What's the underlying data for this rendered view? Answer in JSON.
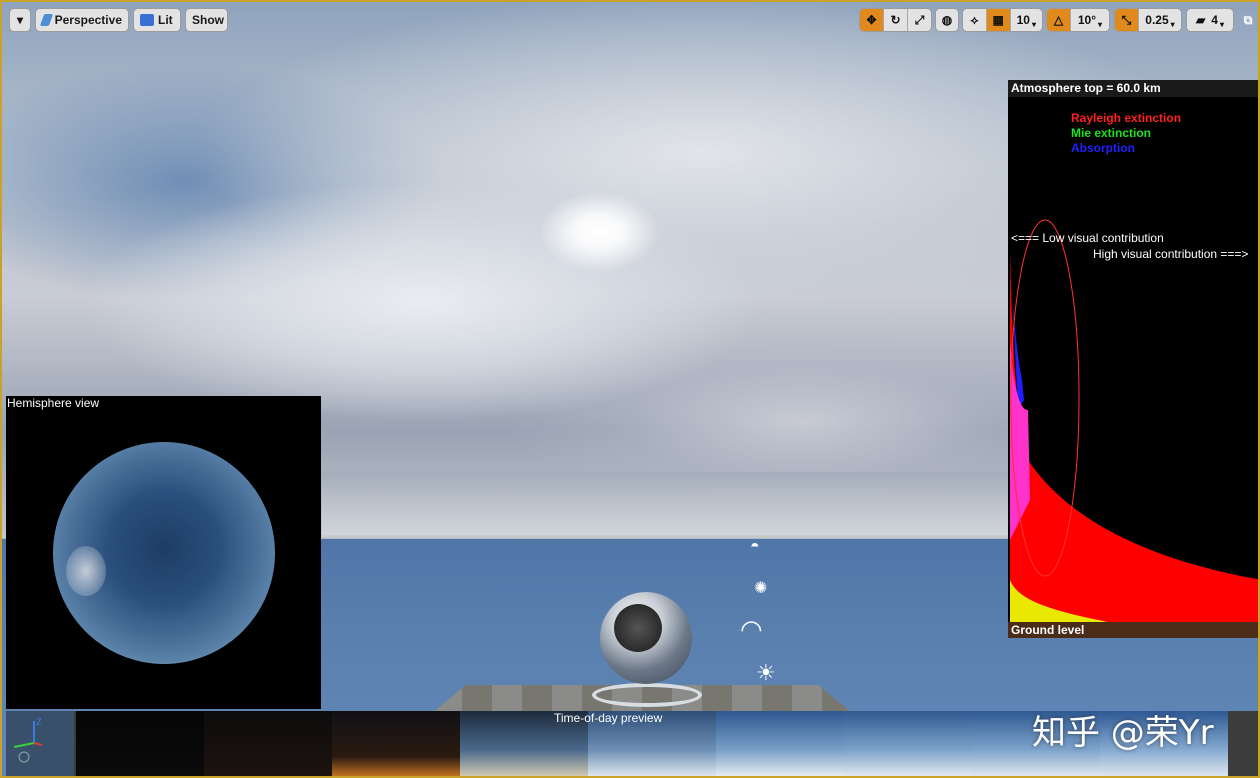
{
  "toolbar": {
    "left": {
      "dropdown_label": "▾",
      "perspective_label": "Perspective",
      "lit_label": "Lit",
      "show_label": "Show"
    },
    "right": {
      "grid_snap_value": "10",
      "rotation_snap_value": "10°",
      "scale_snap_value": "0.25",
      "camera_speed_value": "4"
    }
  },
  "hemisphere_view": {
    "title": "Hemisphere view"
  },
  "atmosphere_panel": {
    "top_label": "Atmosphere top = 60.0 km",
    "legend": [
      {
        "label": "Rayleigh extinction",
        "color": "#ff2020"
      },
      {
        "label": "Mie extinction",
        "color": "#20e020"
      },
      {
        "label": "Absorption",
        "color": "#2020ff"
      }
    ],
    "low_contribution_label": "<=== Low visual contribution",
    "high_contribution_label": "High visual contribution ===>",
    "ground_label": "Ground level"
  },
  "time_of_day": {
    "label": "Time-of-day preview",
    "thumbnails": [
      {
        "name": "night"
      },
      {
        "name": "pre-dawn"
      },
      {
        "name": "dawn"
      },
      {
        "name": "sunrise"
      },
      {
        "name": "morning"
      },
      {
        "name": "midday"
      },
      {
        "name": "afternoon"
      },
      {
        "name": "late-afternoon"
      },
      {
        "name": "dusk-blue"
      }
    ]
  },
  "watermark": "知乎 @荣Yr",
  "colors": {
    "accent_orange": "#e08a1e",
    "viewport_border": "#c9a227"
  }
}
